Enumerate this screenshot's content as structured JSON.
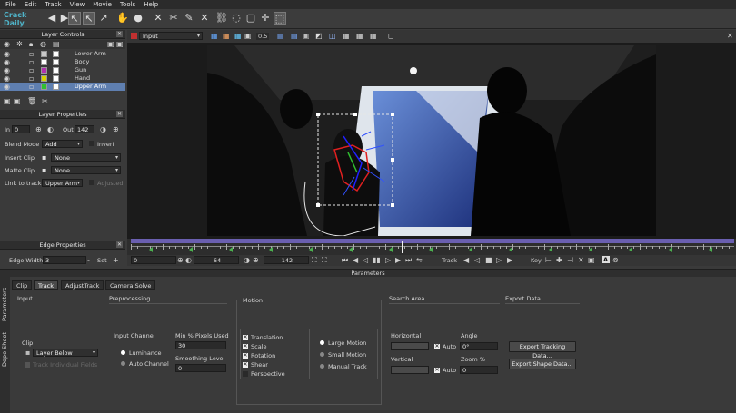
{
  "menu": [
    "File",
    "Edit",
    "Track",
    "View",
    "Movie",
    "Tools",
    "Help"
  ],
  "watermark": "Crack Daily",
  "layer_controls": {
    "title": "Layer Controls",
    "layers": [
      {
        "name": "Lower Arm",
        "color": "#c8c8c8"
      },
      {
        "name": "Body",
        "color": "#ffffff"
      },
      {
        "name": "Gun",
        "color": "#b030b0"
      },
      {
        "name": "Hand",
        "color": "#d4d400"
      },
      {
        "name": "Upper Arm",
        "color": "#30c030"
      }
    ]
  },
  "layer_properties": {
    "title": "Layer Properties",
    "in_label": "In",
    "in_value": "0",
    "out_label": "Out",
    "out_value": "142",
    "blend_mode_label": "Blend Mode",
    "blend_mode_value": "Add",
    "invert_label": "Invert",
    "insert_clip_label": "Insert Clip",
    "insert_clip_value": "None",
    "matte_clip_label": "Matte Clip",
    "matte_clip_value": "None",
    "link_to_track_label": "Link to track",
    "link_to_track_value": "Upper Arm",
    "adjusted_label": "Adjusted"
  },
  "edge_properties": {
    "title": "Edge Properties",
    "edge_width_label": "Edge Width",
    "edge_width_value": "3",
    "set_label": "Set"
  },
  "viewer": {
    "clip_name": "Input",
    "zoom": "0.5"
  },
  "transport": {
    "start": "0",
    "current": "64",
    "end": "142",
    "track_label": "Track",
    "key_label": "Key",
    "a_label": "A"
  },
  "parameters": {
    "title": "Parameters",
    "side_tabs": [
      "Parameters",
      "Dope Sheet"
    ],
    "tabs": [
      "Clip",
      "Track",
      "AdjustTrack",
      "Camera Solve"
    ],
    "active_tab": "Track",
    "input": {
      "title": "Input",
      "clip_label": "Clip",
      "clip_value": "Layer Below",
      "track_inclusion_label": "Track Individual Fields"
    },
    "preprocessing": {
      "title": "Preprocessing",
      "input_channel_label": "Input Channel",
      "luminance_label": "Luminance",
      "auto_channel_label": "Auto Channel",
      "min_pixels_label": "Min % Pixels Used",
      "min_pixels_value": "30",
      "smoothing_label": "Smoothing Level",
      "smoothing_value": "0"
    },
    "motion": {
      "title": "Motion",
      "options": [
        {
          "label": "Translation",
          "checked": true
        },
        {
          "label": "Scale",
          "checked": true
        },
        {
          "label": "Rotation",
          "checked": true
        },
        {
          "label": "Shear",
          "checked": true
        },
        {
          "label": "Perspective",
          "checked": false
        }
      ],
      "modes": [
        {
          "label": "Large Motion",
          "selected": true
        },
        {
          "label": "Small Motion",
          "selected": false
        },
        {
          "label": "Manual Track",
          "selected": false
        }
      ]
    },
    "search_area": {
      "title": "Search Area",
      "horizontal_label": "Horizontal",
      "vertical_label": "Vertical",
      "auto_label": "Auto",
      "angle_label": "Angle",
      "angle_value": "0°",
      "zoom_label": "Zoom %",
      "zoom_value": "0"
    },
    "export_data": {
      "title": "Export Data",
      "export_tracking_label": "Export Tracking Data...",
      "export_shape_label": "Export Shape Data..."
    }
  }
}
